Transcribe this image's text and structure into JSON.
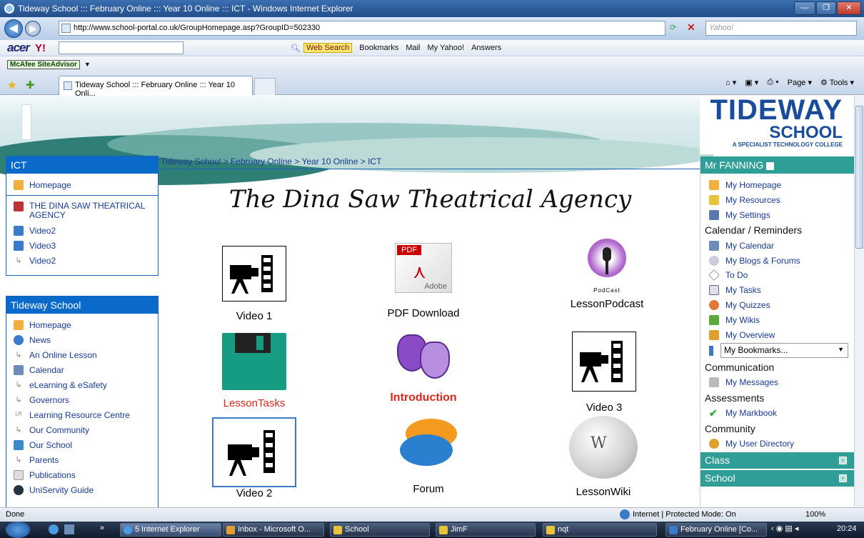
{
  "window": {
    "title": "Tideway School ::: February Online ::: Year 10 Online ::: ICT - Windows Internet Explorer"
  },
  "address": {
    "url": "http://www.school-portal.co.uk/GroupHomepage.asp?GroupID=502330",
    "search_placeholder": "Yahoo!"
  },
  "yahoo_toolbar": {
    "brand": "acer",
    "web_search": "Web Search",
    "bookmarks": "Bookmarks",
    "mail": "Mail",
    "my_yahoo": "My Yahoo!",
    "answers": "Answers"
  },
  "mcafee": {
    "label": "McAfee SiteAdvisor"
  },
  "tab": {
    "label": "Tideway School ::: February Online ::: Year 10 Onli...",
    "page": "Page",
    "tools": "Tools"
  },
  "logo": {
    "line1": "TIDEWAY",
    "line2": "SCHOOL",
    "line3": "A SPECIALIST TECHNOLOGY COLLEGE"
  },
  "ict_panel": {
    "title": "ICT",
    "homepage": "Homepage",
    "items": [
      {
        "label": "THE DINA SAW THEATRICAL AGENCY",
        "icon": "document-icon"
      },
      {
        "label": "Video2",
        "icon": "video-icon"
      },
      {
        "label": "Video3",
        "icon": "video-icon"
      },
      {
        "label": "Video2",
        "icon": "arrow-icon"
      }
    ]
  },
  "school_panel": {
    "title": "Tideway School",
    "items": [
      {
        "label": "Homepage"
      },
      {
        "label": "News"
      },
      {
        "label": "An Online Lesson"
      },
      {
        "label": "Calendar"
      },
      {
        "label": "eLearning & eSafety"
      },
      {
        "label": "Governors"
      },
      {
        "label": "Learning Resource Centre"
      },
      {
        "label": "Our Community"
      },
      {
        "label": "Our School"
      },
      {
        "label": "Parents"
      },
      {
        "label": "Publications"
      },
      {
        "label": "UniServity Guide"
      }
    ]
  },
  "breadcrumb": "Tideway School > February Online > Year 10 Online > ICT",
  "page_heading": "The Dina Saw Theatrical Agency",
  "tiles": {
    "video1": "Video 1",
    "pdf": "PDF Download",
    "podcast": "LessonPodcast",
    "tasks": "LessonTasks",
    "intro": "Introduction",
    "video3": "Video 3",
    "video2": "Video 2",
    "forum": "Forum",
    "wiki": "LessonWiki",
    "pdf_badge": "PDF",
    "adobe": "Adobe",
    "podcast_text": "PodCast"
  },
  "user_panel": {
    "title": "Mr FANNING",
    "links1": [
      "My Homepage",
      "My Resources",
      "My Settings"
    ],
    "calendar_heading": "Calendar / Reminders",
    "links2": [
      "My Calendar",
      "My Blogs & Forums",
      "To Do",
      "My Tasks",
      "My Quizzes",
      "My Wikis",
      "My Overview"
    ],
    "bookmarks": "My Bookmarks...",
    "communication": "Communication",
    "messages": "My Messages",
    "assessments": "Assessments",
    "markbook": "My Markbook",
    "community": "Community",
    "directory": "My User Directory",
    "bar_class": "Class",
    "bar_school": "School"
  },
  "status": {
    "left": "Done",
    "zone": "Internet | Protected Mode: On",
    "zoom": "100%"
  },
  "taskbar": {
    "ie": "5 Internet Explorer",
    "inbox": "Inbox - Microsoft O...",
    "school": "School",
    "jimf": "JimF",
    "nqt": "nqt",
    "feb": "February Online [Co...",
    "time": "20:24"
  }
}
